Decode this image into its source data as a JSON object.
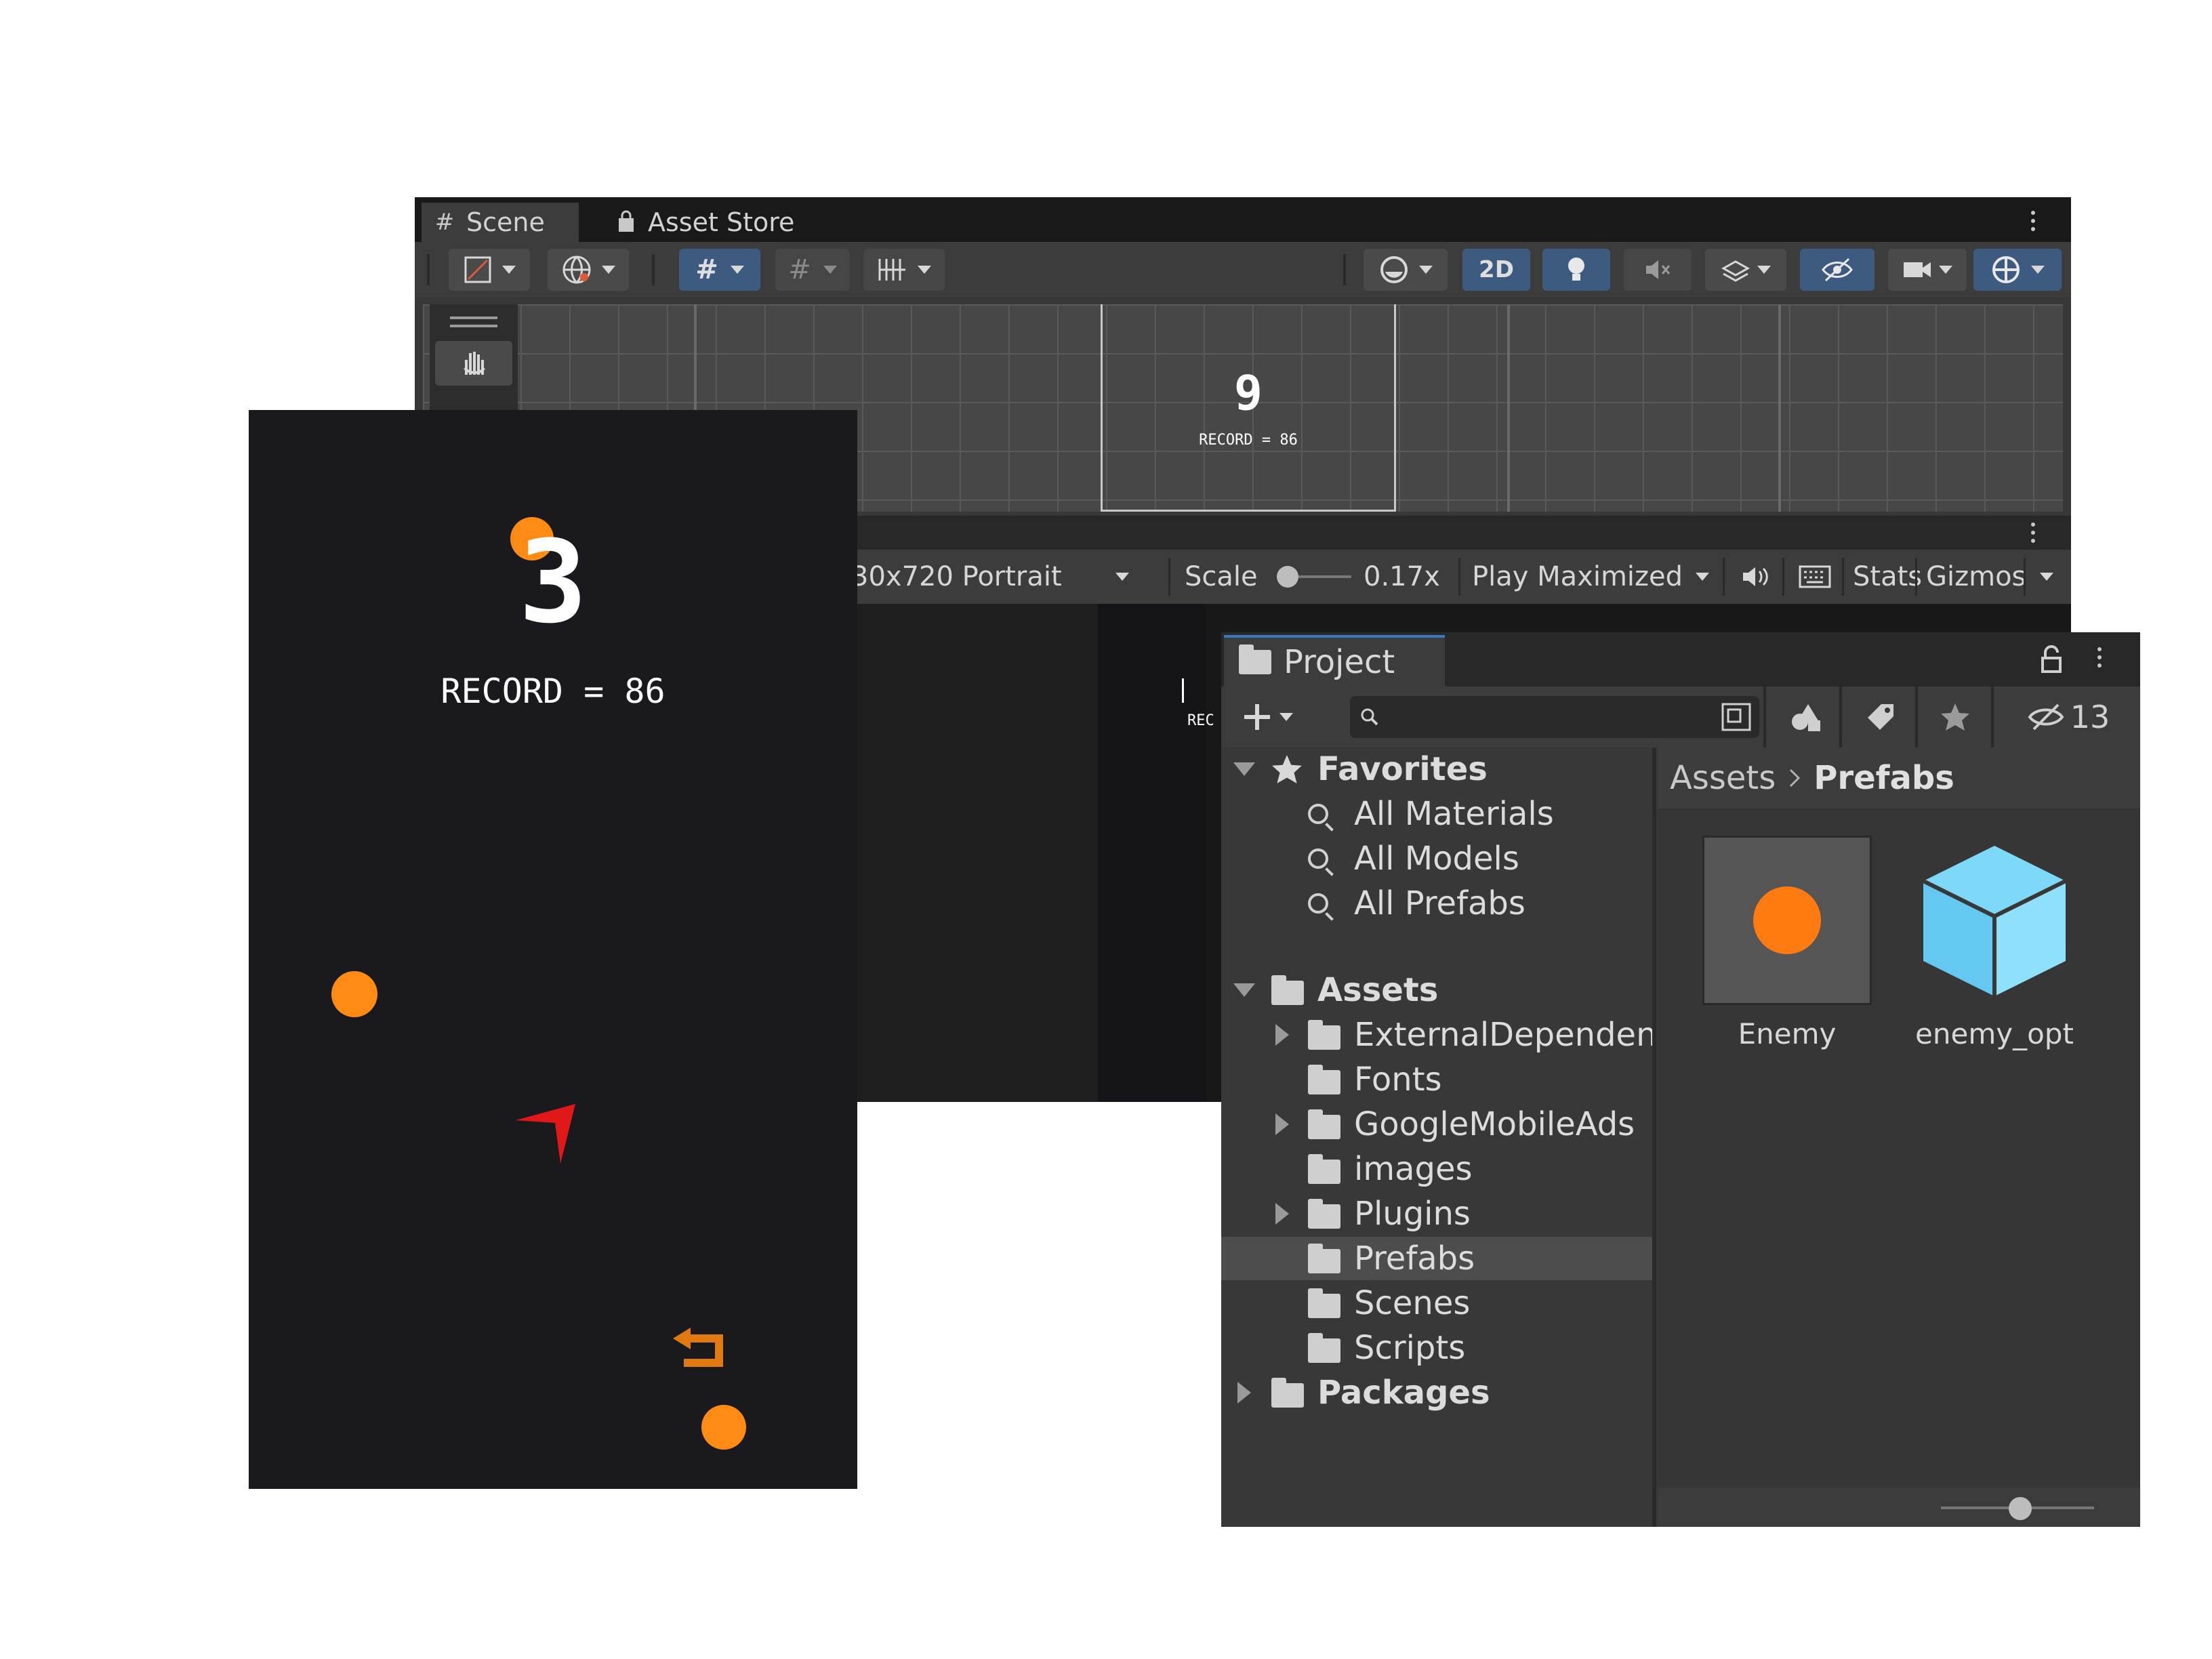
{
  "scene_window": {
    "tabs": [
      {
        "label": "Scene",
        "icon": "grid-hash-icon"
      },
      {
        "label": "Asset Store",
        "icon": "shopping-bag-icon"
      }
    ],
    "toolbar": {
      "two_d_label": "2D"
    },
    "scene_view": {
      "score": "9",
      "record": "RECORD = 86"
    }
  },
  "game_window": {
    "resolution": "30x720 Portrait",
    "scale_label": "Scale",
    "scale_value": "0.17x",
    "play_mode": "Play Maximized",
    "stats_label": "Stats",
    "gizmos_label": "Gizmos",
    "record_fragment": "REC"
  },
  "game": {
    "score": "3",
    "record": "RECORD = 86",
    "colors": {
      "background": "#1a1a1e",
      "ball": "#ff8a14",
      "player": "#e01818",
      "restart": "#e07a10"
    }
  },
  "project_window": {
    "tab_label": "Project",
    "hidden_count": "13",
    "favorites": {
      "label": "Favorites",
      "items": [
        "All Materials",
        "All Models",
        "All Prefabs"
      ]
    },
    "assets": {
      "label": "Assets",
      "items": [
        {
          "label": "ExternalDependenc",
          "expandable": true
        },
        {
          "label": "Fonts",
          "expandable": false
        },
        {
          "label": "GoogleMobileAds",
          "expandable": true
        },
        {
          "label": "images",
          "expandable": false
        },
        {
          "label": "Plugins",
          "expandable": true
        },
        {
          "label": "Prefabs",
          "expandable": false,
          "selected": true
        },
        {
          "label": "Scenes",
          "expandable": false
        },
        {
          "label": "Scripts",
          "expandable": false
        }
      ]
    },
    "packages_label": "Packages",
    "breadcrumb": [
      "Assets",
      "Prefabs"
    ],
    "grid_assets": [
      {
        "label": "Enemy",
        "icon": "orange-ball-prefab-icon"
      },
      {
        "label": "enemy_opt",
        "icon": "blue-cube-model-icon"
      }
    ]
  }
}
